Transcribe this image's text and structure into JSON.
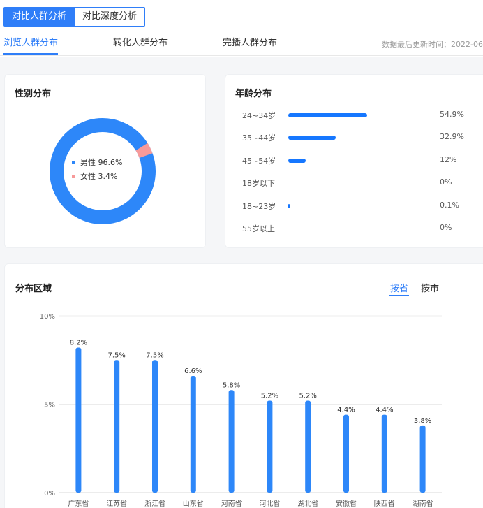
{
  "header": {
    "segments": [
      {
        "label": "对比人群分析",
        "active": true
      },
      {
        "label": "对比深度分析",
        "active": false
      }
    ],
    "tabs": [
      {
        "label": "浏览人群分布",
        "active": true
      },
      {
        "label": "转化人群分布",
        "active": false
      },
      {
        "label": "完播人群分布",
        "active": false
      }
    ],
    "update_text": "数据最后更新时间：2022-06"
  },
  "gender": {
    "title": "性别分布",
    "items": [
      {
        "label": "男性 96.6%",
        "value": 96.6,
        "color": "#2d87f9"
      },
      {
        "label": "女性 3.4%",
        "value": 3.4,
        "color": "#f79a9a"
      }
    ]
  },
  "age": {
    "title": "年龄分布",
    "items": [
      {
        "label": "24~34岁",
        "value_text": "54.9%",
        "value": 54.9
      },
      {
        "label": "35~44岁",
        "value_text": "32.9%",
        "value": 32.9
      },
      {
        "label": "45~54岁",
        "value_text": "12%",
        "value": 12
      },
      {
        "label": "18岁以下",
        "value_text": "0%",
        "value": 0
      },
      {
        "label": "18~23岁",
        "value_text": "0.1%",
        "value": 0.1
      },
      {
        "label": "55岁以上",
        "value_text": "0%",
        "value": 0
      }
    ]
  },
  "region": {
    "title": "分布区域",
    "tabs": [
      {
        "label": "按省",
        "active": true
      },
      {
        "label": "按市",
        "active": false
      }
    ]
  },
  "chart_data": {
    "type": "bar",
    "categories": [
      "广东省",
      "江苏省",
      "浙江省",
      "山东省",
      "河南省",
      "河北省",
      "湖北省",
      "安徽省",
      "陕西省",
      "湖南省"
    ],
    "values": [
      8.2,
      7.5,
      7.5,
      6.6,
      5.8,
      5.2,
      5.2,
      4.4,
      4.4,
      3.8
    ],
    "value_labels": [
      "8.2%",
      "7.5%",
      "7.5%",
      "6.6%",
      "5.8%",
      "5.2%",
      "5.2%",
      "4.4%",
      "4.4%",
      "3.8%"
    ],
    "title": "",
    "xlabel": "",
    "ylabel": "",
    "ylim": [
      0,
      10
    ],
    "yticks": [
      "0%",
      "5%",
      "10%"
    ],
    "grid": true,
    "color": "#2d87f9"
  }
}
